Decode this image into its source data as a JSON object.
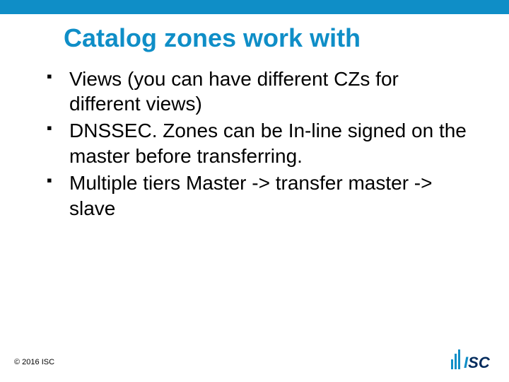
{
  "title": "Catalog zones work with",
  "bullets": [
    "Views (you can have different CZs for different views)",
    "DNSSEC. Zones can be In-line signed on the master before transferring.",
    "Multiple tiers Master -> transfer master -> slave"
  ],
  "footer": {
    "copyright": "© 2016 ISC"
  },
  "logo": {
    "letters": {
      "i": "I",
      "s": "S",
      "c": "C"
    }
  },
  "colors": {
    "accent": "#0f8ec7",
    "dark": "#002a5c"
  }
}
